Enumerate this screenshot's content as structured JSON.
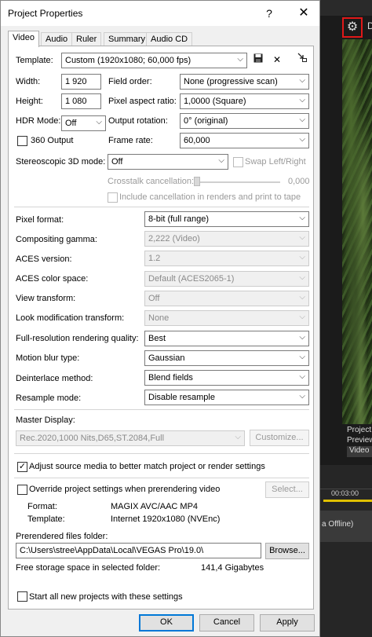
{
  "background": {
    "truncated_label": "D",
    "panel_label_1": "Project",
    "panel_label_2": "Preview",
    "tab_label": "Video",
    "ruler_time": "00:03:00",
    "clip_label": "a Offline)"
  },
  "dialog": {
    "title": "Project Properties",
    "help_label": "?",
    "close_label": "✕"
  },
  "tabs": [
    "Video",
    "Audio",
    "Ruler",
    "Summary",
    "Audio CD"
  ],
  "video": {
    "template_label": "Template:",
    "template_value": "Custom (1920x1080; 60,000 fps)",
    "width_label": "Width:",
    "width_value": "1 920",
    "height_label": "Height:",
    "height_value": "1 080",
    "field_order_label": "Field order:",
    "field_order_value": "None (progressive scan)",
    "pixel_aspect_label": "Pixel aspect ratio:",
    "pixel_aspect_value": "1,0000 (Square)",
    "hdr_mode_label": "HDR Mode:",
    "hdr_mode_value": "Off",
    "output_rotation_label": "Output rotation:",
    "output_rotation_value": "0° (original)",
    "output_360_label": "360 Output",
    "frame_rate_label": "Frame rate:",
    "frame_rate_value": "60,000",
    "stereo_label": "Stereoscopic 3D mode:",
    "stereo_value": "Off",
    "swap_label": "Swap Left/Right",
    "crosstalk_label": "Crosstalk cancellation:",
    "crosstalk_value": "0,000",
    "include_cancel_label": "Include cancellation in renders and print to tape",
    "pixel_format_label": "Pixel format:",
    "pixel_format_value": "8-bit (full range)",
    "compositing_gamma_label": "Compositing gamma:",
    "compositing_gamma_value": "2,222 (Video)",
    "aces_version_label": "ACES version:",
    "aces_version_value": "1.2",
    "aces_color_space_label": "ACES color space:",
    "aces_color_space_value": "Default (ACES2065-1)",
    "view_transform_label": "View transform:",
    "view_transform_value": "Off",
    "look_mod_label": "Look modification transform:",
    "look_mod_value": "None",
    "full_res_label": "Full-resolution rendering quality:",
    "full_res_value": "Best",
    "motion_blur_label": "Motion blur type:",
    "motion_blur_value": "Gaussian",
    "deinterlace_label": "Deinterlace method:",
    "deinterlace_value": "Blend fields",
    "resample_label": "Resample mode:",
    "resample_value": "Disable resample",
    "master_display_label": "Master Display:",
    "master_display_value": "Rec.2020,1000 Nits,D65,ST.2084,Full",
    "customize_label": "Customize...",
    "adjust_label": "Adjust source media to better match project or render settings",
    "override_label": "Override project settings when prerendering video",
    "select_label": "Select...",
    "format_label": "Format:",
    "format_value": "MAGIX AVC/AAC MP4",
    "template2_label": "Template:",
    "template2_value": "Internet 1920x1080 (NVEnc)",
    "prerender_folder_label": "Prerendered files folder:",
    "prerender_folder_value": "C:\\Users\\stree\\AppData\\Local\\VEGAS Pro\\19.0\\",
    "browse_label": "Browse...",
    "free_storage_label": "Free storage space in selected folder:",
    "free_storage_value": "141,4 Gigabytes",
    "start_all_label": "Start all new projects with these settings"
  },
  "buttons": {
    "ok": "OK",
    "cancel": "Cancel",
    "apply": "Apply"
  },
  "icons": {
    "save": "floppy-disk-icon",
    "delete": "x-icon",
    "match_media": "match-media-icon",
    "gear": "gear-icon",
    "dropdown": "chevron-down-icon"
  },
  "colors": {
    "highlight_border": "#e01818",
    "primary_button_border": "#0078d7"
  }
}
